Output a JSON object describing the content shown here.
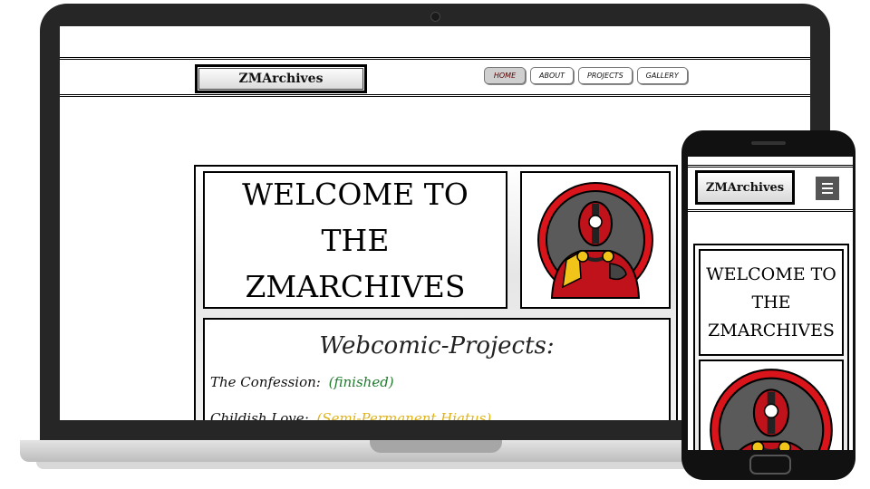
{
  "site": {
    "logo_text": "ZMArchives",
    "nav": [
      "HOME",
      "ABOUT",
      "PROJECTS",
      "GALLERY"
    ],
    "active_nav": "HOME",
    "welcome_line1": "WELCOME TO THE",
    "welcome_line2": "ZMARCHIVES",
    "projects_heading": "Webcomic-Projects:",
    "projects": [
      {
        "title": "The Confession:",
        "status": "(finished)",
        "status_color": "#1f7a2e"
      },
      {
        "title": "Childish Love:",
        "status": "(Semi-Permanent Hiatus)",
        "status_color": "#e0b21a"
      }
    ]
  },
  "mobile": {
    "logo_text": "ZMArchives",
    "menu_icon": "hamburger-menu-icon",
    "welcome_line1": "WELCOME TO",
    "welcome_line2": "THE",
    "welcome_line3": "ZMARCHIVES"
  },
  "colors": {
    "device_dark": "#262626",
    "hero_red": "#d9141b",
    "hero_bg": "#5a5a5a"
  }
}
